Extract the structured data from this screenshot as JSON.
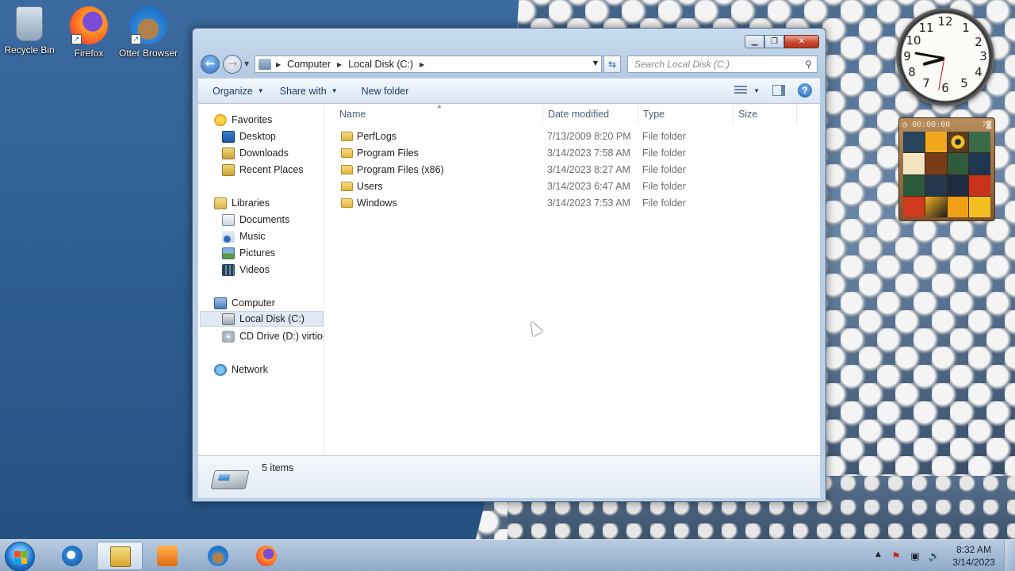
{
  "desktop": {
    "icons": [
      {
        "label": "Recycle Bin",
        "icon": "recycle-bin-icon"
      },
      {
        "label": "Firefox",
        "icon": "firefox-icon"
      },
      {
        "label": "Otter Browser",
        "icon": "otter-browser-icon"
      }
    ]
  },
  "window": {
    "address": {
      "crumbs": [
        "Computer",
        "Local Disk (C:)"
      ]
    },
    "search": {
      "placeholder": "Search Local Disk (C:)"
    },
    "toolbar": {
      "organize": "Organize",
      "share_with": "Share with",
      "new_folder": "New folder"
    },
    "nav": {
      "favorites": "Favorites",
      "favorites_items": [
        "Desktop",
        "Downloads",
        "Recent Places"
      ],
      "libraries": "Libraries",
      "libraries_items": [
        "Documents",
        "Music",
        "Pictures",
        "Videos"
      ],
      "computer": "Computer",
      "computer_items": [
        "Local Disk (C:)",
        "CD Drive (D:) virtio-win"
      ],
      "network": "Network"
    },
    "columns": {
      "name": "Name",
      "date": "Date modified",
      "type": "Type",
      "size": "Size"
    },
    "rows": [
      {
        "name": "PerfLogs",
        "date": "7/13/2009 8:20 PM",
        "type": "File folder"
      },
      {
        "name": "Program Files",
        "date": "3/14/2023 7:58 AM",
        "type": "File folder"
      },
      {
        "name": "Program Files (x86)",
        "date": "3/14/2023 8:27 AM",
        "type": "File folder"
      },
      {
        "name": "Users",
        "date": "3/14/2023 6:47 AM",
        "type": "File folder"
      },
      {
        "name": "Windows",
        "date": "3/14/2023 7:53 AM",
        "type": "File folder"
      }
    ],
    "details": {
      "count": "5 items"
    }
  },
  "gadgets": {
    "clock_numbers": [
      "12",
      "1",
      "2",
      "3",
      "4",
      "5",
      "6",
      "7",
      "8",
      "9",
      "10",
      "11"
    ],
    "puzzle_timer": "00:00:00"
  },
  "taskbar": {
    "time": "8:32 AM",
    "date": "3/14/2023"
  }
}
